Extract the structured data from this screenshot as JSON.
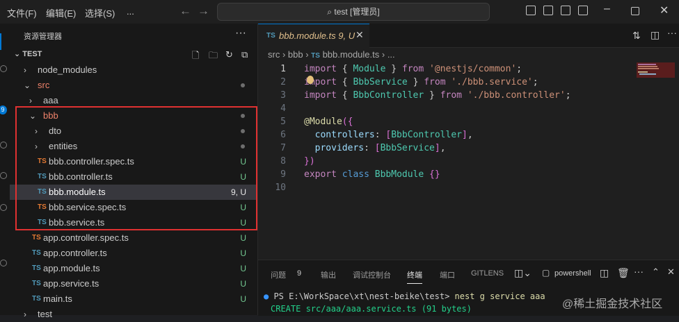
{
  "menu": [
    "文件(F)",
    "编辑(E)",
    "选择(S)",
    "..."
  ],
  "search": {
    "text": "test [管理员]"
  },
  "sidebar": {
    "title": "资源管理器",
    "project": "TEST",
    "rows": [
      {
        "label": "node_modules",
        "kind": "folder",
        "indent": 1,
        "open": false,
        "status": ""
      },
      {
        "label": "src",
        "kind": "folder",
        "indent": 1,
        "open": true,
        "status": "dot",
        "color": "#f0836b"
      },
      {
        "label": "aaa",
        "kind": "folder",
        "indent": 2,
        "open": false,
        "status": ""
      },
      {
        "label": "bbb",
        "kind": "folder",
        "indent": 2,
        "open": true,
        "status": "dot",
        "color": "#f0836b"
      },
      {
        "label": "dto",
        "kind": "folder",
        "indent": 3,
        "open": false,
        "status": "dot"
      },
      {
        "label": "entities",
        "kind": "folder",
        "indent": 3,
        "open": false,
        "status": "dot"
      },
      {
        "label": "bbb.controller.spec.ts",
        "kind": "ts",
        "indent": 3,
        "status": "U",
        "tscolor": "#e37933"
      },
      {
        "label": "bbb.controller.ts",
        "kind": "ts",
        "indent": 3,
        "status": "U",
        "tscolor": "#519aba"
      },
      {
        "label": "bbb.module.ts",
        "kind": "ts",
        "indent": 3,
        "status": "9, U",
        "tscolor": "#519aba",
        "selected": true
      },
      {
        "label": "bbb.service.spec.ts",
        "kind": "ts",
        "indent": 3,
        "status": "U",
        "tscolor": "#e37933"
      },
      {
        "label": "bbb.service.ts",
        "kind": "ts",
        "indent": 3,
        "status": "U",
        "tscolor": "#519aba"
      },
      {
        "label": "app.controller.spec.ts",
        "kind": "ts",
        "indent": 2,
        "status": "U",
        "tscolor": "#e37933"
      },
      {
        "label": "app.controller.ts",
        "kind": "ts",
        "indent": 2,
        "status": "U",
        "tscolor": "#519aba"
      },
      {
        "label": "app.module.ts",
        "kind": "ts",
        "indent": 2,
        "status": "U",
        "tscolor": "#519aba"
      },
      {
        "label": "app.service.ts",
        "kind": "ts",
        "indent": 2,
        "status": "U",
        "tscolor": "#519aba"
      },
      {
        "label": "main.ts",
        "kind": "ts",
        "indent": 2,
        "status": "U",
        "tscolor": "#519aba"
      },
      {
        "label": "test",
        "kind": "folder",
        "indent": 1,
        "open": false,
        "status": ""
      }
    ]
  },
  "editor": {
    "tab": {
      "icon": "TS",
      "name": "bbb.module.ts",
      "status": "9, U"
    },
    "breadcrumb": [
      "src",
      "bbb",
      "bbb.module.ts",
      "..."
    ],
    "lines": [
      {
        "n": "1",
        "html": "<span class='kw'>import</span> <span class='pl'>{</span> <span class='ty'>Module</span> <span class='pl'>}</span> <span class='kw'>from</span> <span class='st2'>'@nestjs/common'</span><span class='pl'>;</span>"
      },
      {
        "n": "2",
        "html": "<span class='kw'>import</span> <span class='pl'>{</span> <span class='ty'>BbbService</span> <span class='pl'>}</span> <span class='kw'>from</span> <span class='st2'>'./bbb.service'</span><span class='pl'>;</span>"
      },
      {
        "n": "3",
        "html": "<span class='kw'>import</span> <span class='pl'>{</span> <span class='ty'>BbbController</span> <span class='pl'>}</span> <span class='kw'>from</span> <span class='st2'>'./bbb.controller'</span><span class='pl'>;</span>"
      },
      {
        "n": "4",
        "html": ""
      },
      {
        "n": "5",
        "html": "<span class='dec'>@Module</span><span class='br'>({</span>"
      },
      {
        "n": "6",
        "html": "  <span class='pr'>controllers</span><span class='pl'>:</span> <span class='br'>[</span><span class='ty'>BbbController</span><span class='br'>]</span><span class='pl'>,</span>"
      },
      {
        "n": "7",
        "html": "  <span class='pr'>providers</span><span class='pl'>:</span> <span class='br'>[</span><span class='ty'>BbbService</span><span class='br'>]</span><span class='pl'>,</span>"
      },
      {
        "n": "8",
        "html": "<span class='br'>})</span>"
      },
      {
        "n": "9",
        "html": "<span class='kw'>export</span> <span class='kb'>class</span> <span class='ty'>BbbModule</span> <span class='br'>{}</span>"
      },
      {
        "n": "10",
        "html": ""
      }
    ]
  },
  "panel": {
    "tabs": [
      "问题",
      "9",
      "输出",
      "调试控制台",
      "终端",
      "端口",
      "GITLENS"
    ],
    "shell": "powershell",
    "terminal": [
      {
        "prefix": "PS E:\\WorkSpace\\xt\\nest-beike\\test> ",
        "cmd": "nest g service aaa"
      },
      {
        "prefix": "",
        "cmd": "CREATE src/aaa/aaa.service.ts (91 bytes)"
      }
    ]
  },
  "watermark": "@稀土掘金技术社区"
}
